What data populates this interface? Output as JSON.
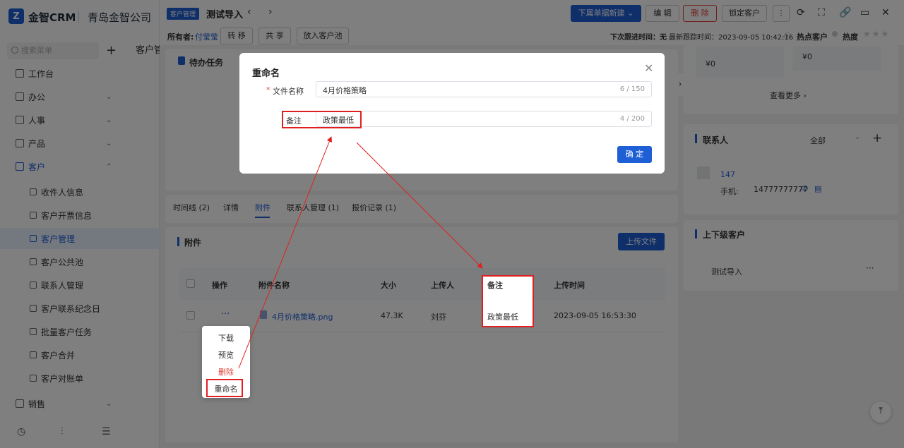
{
  "sidebar": {
    "logo_glyph": "Z",
    "brand": "金智CRM",
    "company": "青岛金智公司",
    "search_placeholder": "搜索菜单",
    "items": [
      {
        "label": "工作台",
        "icon": "dashboard-icon"
      },
      {
        "label": "办公",
        "icon": "office-icon"
      },
      {
        "label": "人事",
        "icon": "person-icon"
      },
      {
        "label": "产品",
        "icon": "product-icon"
      },
      {
        "label": "客户",
        "icon": "customer-icon"
      },
      {
        "label": "收件人信息",
        "icon": "recipient-icon"
      },
      {
        "label": "客户开票信息",
        "icon": "invoice-icon"
      },
      {
        "label": "客户管理",
        "icon": "manage-icon"
      },
      {
        "label": "客户公共池",
        "icon": "pool-icon"
      },
      {
        "label": "联系人管理",
        "icon": "contact-icon"
      },
      {
        "label": "客户联系纪念日",
        "icon": "anniversary-icon"
      },
      {
        "label": "批量客户任务",
        "icon": "task-icon"
      },
      {
        "label": "客户合并",
        "icon": "merge-icon"
      },
      {
        "label": "客户对账单",
        "icon": "statement-icon"
      },
      {
        "label": "销售",
        "icon": "sales-icon"
      }
    ]
  },
  "background": {
    "tab": "客户管"
  },
  "header": {
    "tag": "客户管理",
    "title": "测试导入",
    "buttons": {
      "new_sub": "下属单据新建",
      "edit": "编 辑",
      "delete": "删 除",
      "lock": "锁定客户"
    }
  },
  "owner_row": {
    "owner_label": "所有者:",
    "owner_name": "付莹莹",
    "transfer": "转 移",
    "share": "共 享",
    "pool": "放入客户池",
    "next_follow": "下次跟进时间：无",
    "latest_follow": "最新跟踪时间：2023-09-05 10:42:16",
    "hot": "热点客户",
    "heat": "热度"
  },
  "todo": {
    "title": "待办任务"
  },
  "tabs": [
    "时间线 (2)",
    "详情",
    "附件",
    "联系人管理 (1)",
    "报价记录 (1)"
  ],
  "attachments": {
    "title": "附件",
    "upload": "上传文件",
    "columns": [
      "操作",
      "附件名称",
      "大小",
      "上传人",
      "备注",
      "上传时间"
    ],
    "row": {
      "action": "···",
      "name": "4月价格策略.png",
      "size": "47.3K",
      "uploader": "刘芬",
      "note": "政策最低",
      "time": "2023-09-05 16:53:30"
    }
  },
  "row_menu": [
    "下载",
    "预览",
    "删除",
    "重命名"
  ],
  "right_panel": {
    "amount_a": "¥0",
    "amount_b": "¥0",
    "see_more": "查看更多",
    "contacts_title": "联系人",
    "contacts_filter": "全部",
    "contact_name": "147",
    "phone_label": "手机:",
    "phone": "14777777777",
    "parent_title": "上下级客户",
    "parent_item": "测试导入",
    "more": "···"
  },
  "modal": {
    "title": "重命名",
    "required_mark": "*",
    "file_label": "文件名称",
    "file_value": "4月价格策略",
    "file_count": "6 / 150",
    "note_label": "备注",
    "note_value": "政策最低",
    "note_count": "4 / 200",
    "confirm": "确 定"
  },
  "colors": {
    "accent": "#1f5fd6",
    "danger": "#e0453e",
    "annotation": "#e02020"
  }
}
